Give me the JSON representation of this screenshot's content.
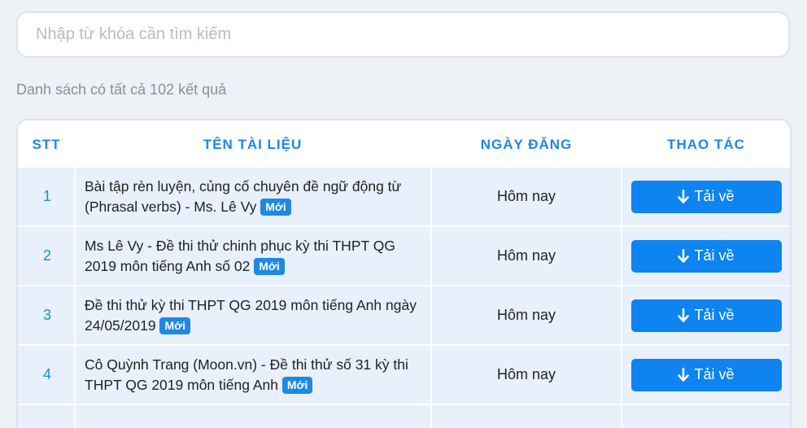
{
  "search": {
    "placeholder": "Nhập từ khóa cần tìm kiếm",
    "value": ""
  },
  "summary": "Danh sách có tất cả 102 kết quả",
  "table": {
    "headers": {
      "stt": "STT",
      "name": "TÊN TÀI LIỆU",
      "date": "NGÀY ĐĂNG",
      "action": "THAO TÁC"
    },
    "rows": [
      {
        "stt": "1",
        "title": "Bài tập rèn luyện, củng cố chuyên đề ngữ động từ (Phrasal verbs) - Ms. Lê Vy",
        "badge": "Mới",
        "date": "Hôm nay",
        "action": "Tải về"
      },
      {
        "stt": "2",
        "title": "Ms Lê Vy - Đề thi thử chinh phục kỳ thi THPT QG 2019 môn tiếng Anh số 02",
        "badge": "Mới",
        "date": "Hôm nay",
        "action": "Tải về"
      },
      {
        "stt": "3",
        "title": "Đề thi thử kỳ thi THPT QG 2019 môn tiếng Anh ngày 24/05/2019",
        "badge": "Mới",
        "date": "Hôm nay",
        "action": "Tải về"
      },
      {
        "stt": "4",
        "title": "Cô Quỳnh Trang (Moon.vn) - Đề thi thử số 31 kỳ thi THPT QG 2019 môn tiếng Anh",
        "badge": "Mới",
        "date": "Hôm nay",
        "action": "Tải về"
      }
    ]
  },
  "icons": {
    "download": "arrow-down-icon"
  },
  "colors": {
    "accent": "#1e88e5",
    "button": "#0d84f0",
    "row_bg": "#e8f0fb"
  }
}
